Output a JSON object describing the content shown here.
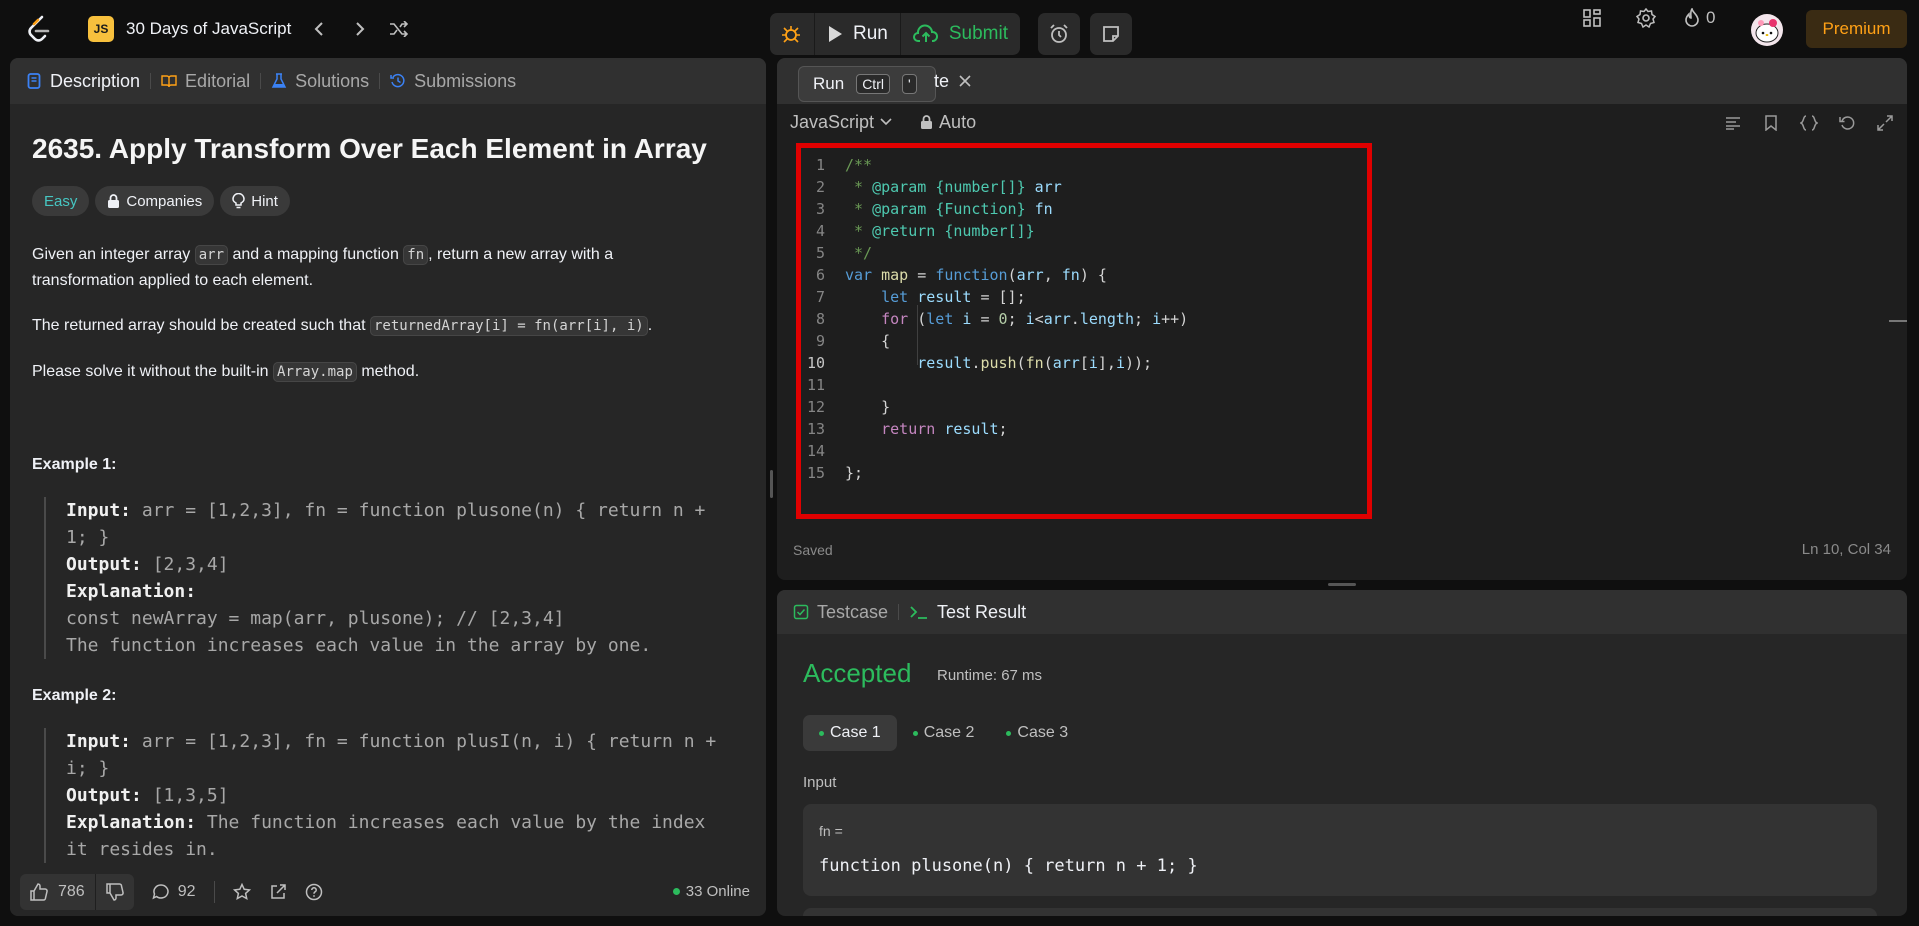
{
  "topbar": {
    "course_badge": "JS",
    "course_title": "30 Days of JavaScript",
    "run_label": "Run",
    "submit_label": "Submit",
    "streak_count": "0",
    "premium_label": "Premium"
  },
  "left": {
    "tabs": [
      "Description",
      "Editorial",
      "Solutions",
      "Submissions"
    ],
    "title": "2635. Apply Transform Over Each Element in Array",
    "tags": {
      "difficulty": "Easy",
      "companies": "Companies",
      "hint": "Hint"
    },
    "p1": {
      "a": "Given an integer array ",
      "code1": "arr",
      "b": " and a mapping function ",
      "code2": "fn",
      "c": ", return a new array with a",
      "d": "transformation applied to each element."
    },
    "p2": {
      "a": "The returned array should be created such that ",
      "code": "returnedArray[i] = fn(arr[i], i)",
      "b": "."
    },
    "p3": {
      "a": "Please solve it without the built-in ",
      "code": "Array.map",
      "b": " method."
    },
    "example1": {
      "title": "Example 1:",
      "input_label": "Input:",
      "input_line1": " arr = [1,2,3], fn = function plusone(n) { return n +",
      "input_line2": "1; }",
      "output_label": "Output:",
      "output": " [2,3,4]",
      "explanation_label": "Explanation:",
      "expl_line1": "const newArray = map(arr, plusone); // [2,3,4]",
      "expl_line2": "The function increases each value in the array by one."
    },
    "example2": {
      "title": "Example 2:",
      "input_label": "Input:",
      "input_line1": " arr = [1,2,3], fn = function plusI(n, i) { return n +",
      "input_line2": "i; }",
      "output_label": "Output:",
      "output": " [1,3,5]",
      "explanation_label": "Explanation:",
      "expl_line1": " The function increases each value by the index",
      "expl_line2": "it resides in."
    },
    "footer": {
      "likes": "786",
      "comments": "92",
      "online": "33 Online"
    }
  },
  "editor": {
    "tooltip_label": "Run",
    "tooltip_key1": "Ctrl",
    "tooltip_key2": "'",
    "tab_fragment": "te",
    "language": "JavaScript",
    "auto_label": "Auto",
    "status_saved": "Saved",
    "cursor_pos": "Ln 10, Col 34",
    "line_numbers": [
      "1",
      "2",
      "3",
      "4",
      "5",
      "6",
      "7",
      "8",
      "9",
      "10",
      "11",
      "12",
      "13",
      "14",
      "15"
    ]
  },
  "result": {
    "tabs": [
      "Testcase",
      "Test Result"
    ],
    "status": "Accepted",
    "runtime": "Runtime: 67 ms",
    "cases": [
      "Case 1",
      "Case 2",
      "Case 3"
    ],
    "input_label": "Input",
    "param_name": "fn =",
    "param_value": "function plusone(n) { return n + 1; }"
  },
  "colors": {
    "accent_orange": "#ffa116",
    "success_green": "#2cbb5d",
    "easy_teal": "#46c6c2",
    "annotation_red": "#e00000"
  }
}
